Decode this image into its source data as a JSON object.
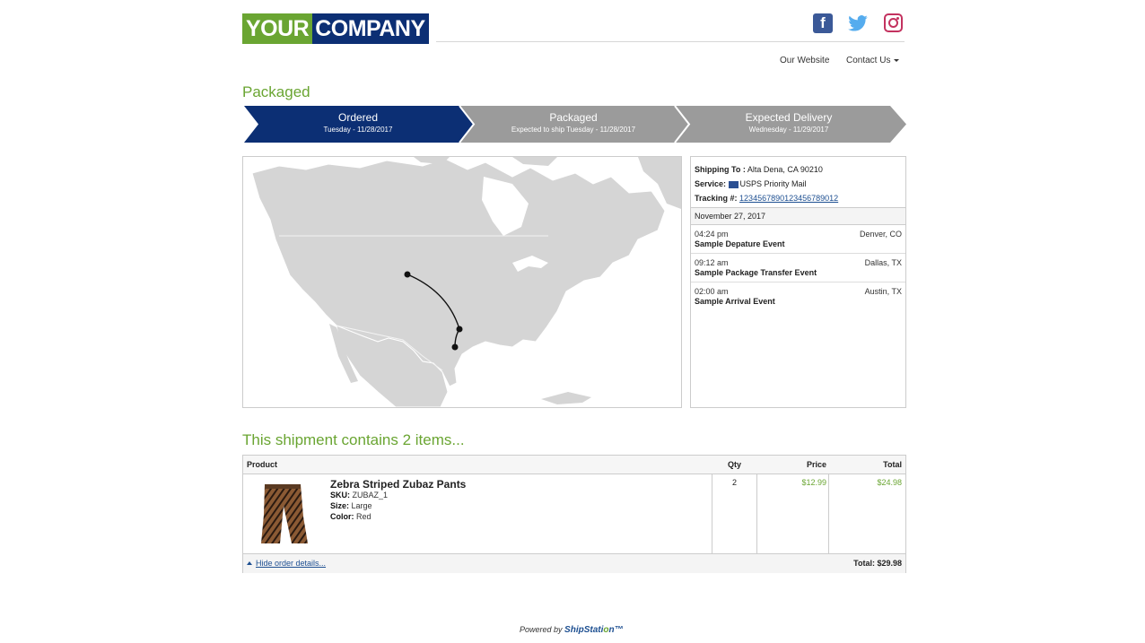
{
  "logo": {
    "part1": "YOUR",
    "part2": "COMPANY"
  },
  "social": {
    "facebook_glyph": "f",
    "icons": [
      "facebook-icon",
      "twitter-icon",
      "instagram-icon"
    ]
  },
  "nav": {
    "website": "Our Website",
    "contact": "Contact Us"
  },
  "status_title": "Packaged",
  "steps": [
    {
      "title": "Ordered",
      "subtitle": "Tuesday - 11/28/2017",
      "color": "#0c2f74"
    },
    {
      "title": "Packaged",
      "subtitle": "Expected to ship Tuesday - 11/28/2017",
      "color": "#9b9b9b"
    },
    {
      "title": "Expected Delivery",
      "subtitle": "Wednesday - 11/29/2017",
      "color": "#9b9b9b"
    }
  ],
  "shipping": {
    "to_label": "Shipping To :",
    "to_value": "Alta Dena, CA 90210",
    "service_label": "Service:",
    "service_value": "USPS Priority Mail",
    "tracking_label": "Tracking #:",
    "tracking_value": "1234567890123456789012"
  },
  "date_header": "November 27, 2017",
  "events": [
    {
      "time": "04:24 pm",
      "name": "Sample Depature Event",
      "location": "Denver, CO"
    },
    {
      "time": "09:12 am",
      "name": "Sample Package Transfer Event",
      "location": "Dallas, TX"
    },
    {
      "time": "02:00 am",
      "name": "Sample Arrival Event",
      "location": "Austin, TX"
    }
  ],
  "contains_title": "This shipment contains 2 items...",
  "table": {
    "headers": {
      "product": "Product",
      "qty": "Qty",
      "price": "Price",
      "total": "Total"
    },
    "item": {
      "name": "Zebra Striped Zubaz Pants",
      "sku_label": "SKU:",
      "sku": "ZUBAZ_1",
      "size_label": "Size:",
      "size": "Large",
      "color_label": "Color:",
      "color": "Red",
      "qty": "2",
      "price": "$12.99",
      "total": "$24.98"
    },
    "hide_link": "Hide order details...",
    "grand_total": "Total: $29.98"
  },
  "footer": {
    "powered": "Powered by",
    "brand_a": "ShipStati",
    "brand_b": "o",
    "brand_c": "n",
    "tm": "™"
  },
  "colors": {
    "brand_green": "#6aa532",
    "brand_navy": "#0c2f74",
    "step_gray": "#9b9b9b",
    "link": "#1d4f91"
  }
}
